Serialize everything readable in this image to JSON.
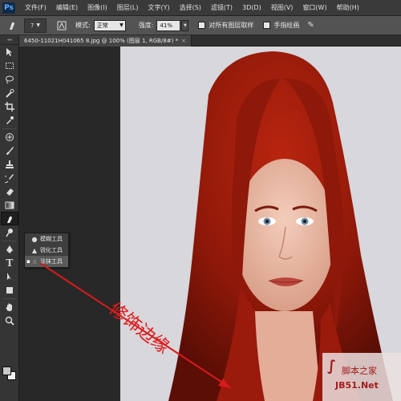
{
  "app": {
    "logo": "Ps"
  },
  "menu": [
    {
      "label": "文件(F)"
    },
    {
      "label": "编辑(E)"
    },
    {
      "label": "图像(I)"
    },
    {
      "label": "图层(L)"
    },
    {
      "label": "文字(Y)"
    },
    {
      "label": "选择(S)"
    },
    {
      "label": "滤镜(T)"
    },
    {
      "label": "3D(D)"
    },
    {
      "label": "视图(V)"
    },
    {
      "label": "窗口(W)"
    },
    {
      "label": "帮助(H)"
    }
  ],
  "options": {
    "brush_size": "7",
    "mode_label": "模式:",
    "mode_value": "正常",
    "strength_label": "强度:",
    "strength_value": "41%",
    "sample_all_label": "对所有图层取样",
    "finger_paint_label": "手指绘画"
  },
  "tab": {
    "title": "6450-11021H041065 8.jpg @ 100% (图层 1, RGB/8#) *",
    "close": "×"
  },
  "flyout": {
    "items": [
      {
        "label": "模糊工具",
        "icon": "blur-drop-icon",
        "selected": false
      },
      {
        "label": "锐化工具",
        "icon": "sharpen-triangle-icon",
        "selected": false
      },
      {
        "label": "涂抹工具",
        "icon": "smudge-finger-icon",
        "selected": true
      }
    ]
  },
  "annotation": {
    "text": "修饰边缘",
    "color": "#e21a1a"
  },
  "watermark": {
    "line1": "脚本之家",
    "line2": "JB51.Net"
  },
  "colors": {
    "hair": "#9a1a0c",
    "skin": "#e8b9a4",
    "canvas_bg": "#d7d7dc"
  }
}
